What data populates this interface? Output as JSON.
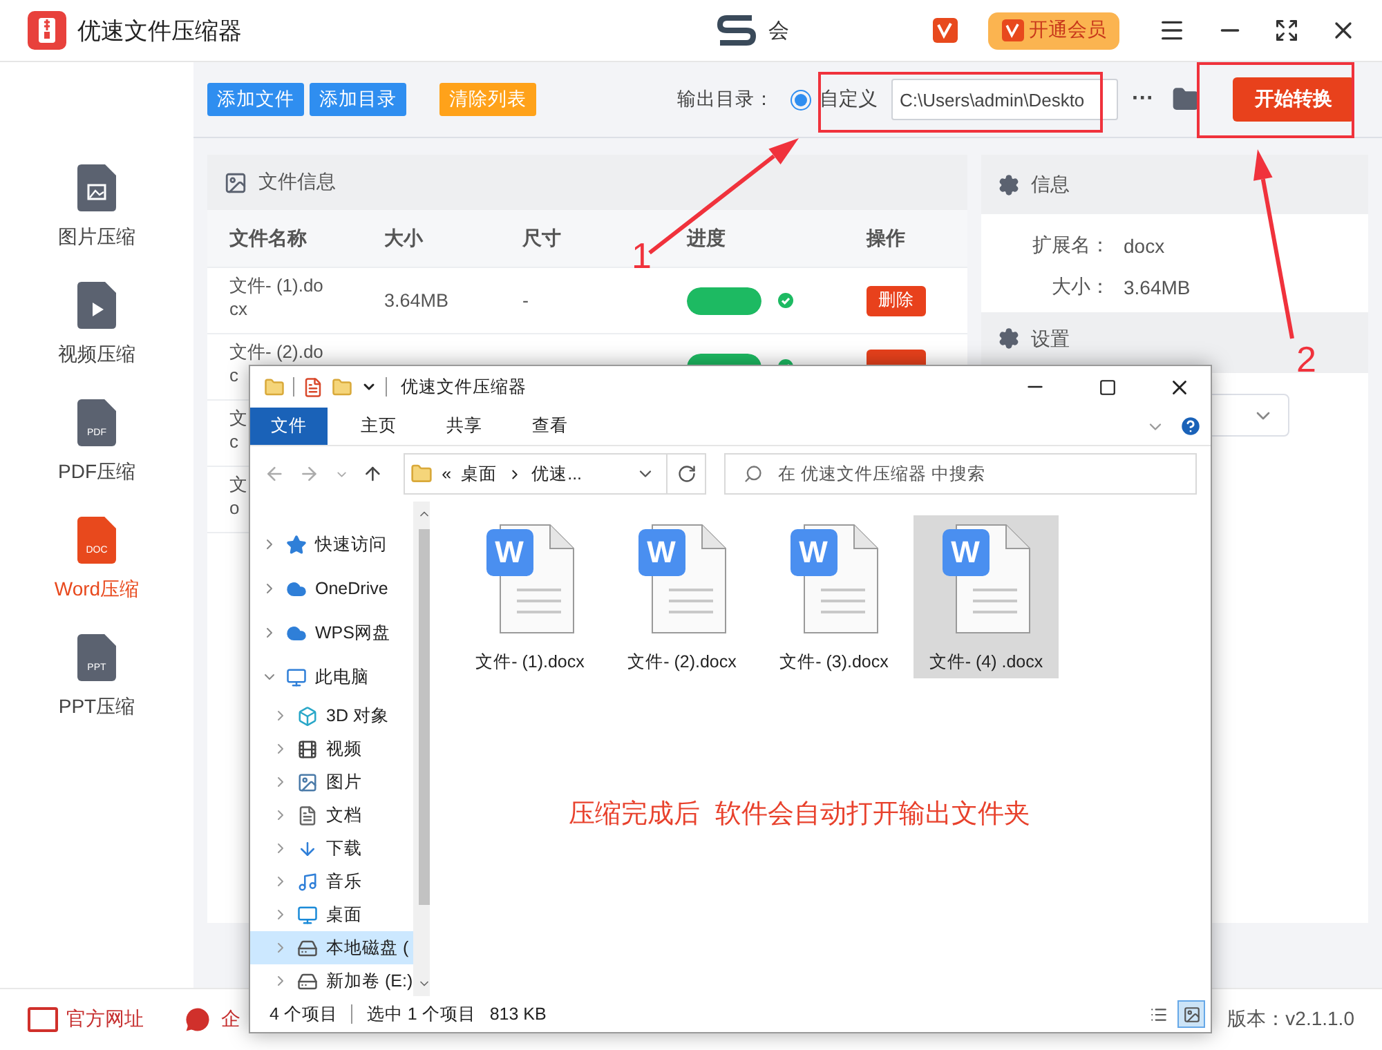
{
  "app": {
    "title": "优速文件压缩器",
    "user_name": "会",
    "vip_button": "开通会员"
  },
  "sidebar": {
    "items": [
      {
        "kind": "image",
        "label": "图片压缩",
        "selected": false
      },
      {
        "kind": "video",
        "label": "视频压缩",
        "selected": false
      },
      {
        "kind": "doc",
        "icon_label": "PDF",
        "label": "PDF压缩",
        "selected": false
      },
      {
        "kind": "doc",
        "icon_label": "DOC",
        "label": "Word压缩",
        "selected": true
      },
      {
        "kind": "doc",
        "icon_label": "PPT",
        "label": "PPT压缩",
        "selected": false
      }
    ]
  },
  "toolbar": {
    "buttons": [
      {
        "kind": "primary",
        "label": "添加文件"
      },
      {
        "kind": "primary",
        "label": "添加目录"
      },
      {
        "kind": "warning",
        "label": "清除列表"
      }
    ],
    "output": {
      "label": "输出目录：",
      "option": "自定义",
      "selected": true,
      "path": "C:\\Users\\admin\\Deskto",
      "more": "···"
    },
    "start_button": "开始转换"
  },
  "file_panel": {
    "title": "文件信息",
    "columns": [
      "文件名称",
      "大小",
      "尺寸",
      "进度",
      "操作"
    ],
    "rows": [
      {
        "name": "文件- (1).do\ncx",
        "size": "3.64MB",
        "dims": "-",
        "level": 1,
        "done": true,
        "action": "删除"
      },
      {
        "name": "文件- (2).do\nc",
        "level": 1,
        "done": true
      },
      {
        "name": "文\nc"
      },
      {
        "name": "文\no"
      }
    ]
  },
  "info_panel": {
    "title": "信息",
    "fields": [
      {
        "label": "扩展名：",
        "value": "docx"
      },
      {
        "label": "大小：",
        "value": "3.64MB"
      }
    ],
    "settings_title": "设置"
  },
  "annotations": {
    "labels": [
      "1",
      "2"
    ],
    "note": "压缩完成后  软件会自动打开输出文件夹"
  },
  "explorer": {
    "title": "优速文件压缩器",
    "tabs": [
      {
        "label": "文件",
        "selected": true
      },
      {
        "label": "主页",
        "selected": false
      },
      {
        "label": "共享",
        "selected": false
      },
      {
        "label": "查看",
        "selected": false
      }
    ],
    "address": {
      "overflow": "«",
      "crumbs": [
        "桌面",
        "优速..."
      ]
    },
    "search": {
      "placeholder": "在 优速文件压缩器 中搜索"
    },
    "tree": [
      {
        "kind": "star",
        "label": "快速访问",
        "expanded": false,
        "selected": false
      },
      {
        "kind": "cloud",
        "label": "OneDrive",
        "expanded": false,
        "selected": false
      },
      {
        "kind": "cloud",
        "label": "WPS网盘",
        "expanded": false,
        "selected": false
      },
      {
        "kind": "pc",
        "label": "此电脑",
        "expanded": true,
        "selected": false,
        "children": [
          {
            "kind": "cube",
            "label": "3D 对象",
            "selected": false
          },
          {
            "kind": "film",
            "label": "视频",
            "selected": false
          },
          {
            "kind": "picture",
            "label": "图片",
            "selected": false
          },
          {
            "kind": "document",
            "label": "文档",
            "selected": false
          },
          {
            "kind": "download",
            "label": "下载",
            "selected": false
          },
          {
            "kind": "music",
            "label": "音乐",
            "selected": false
          },
          {
            "kind": "desktop",
            "label": "桌面",
            "selected": false
          },
          {
            "kind": "drive",
            "label": "本地磁盘 (",
            "selected": true
          },
          {
            "kind": "drive",
            "label": "新加卷 (E:)",
            "selected": false
          }
        ]
      }
    ],
    "files": [
      {
        "name": "文件- (1).docx",
        "badge": "W",
        "selected": false
      },
      {
        "name": "文件- (2).docx",
        "badge": "W",
        "selected": false
      },
      {
        "name": "文件- (3).docx",
        "badge": "W",
        "selected": false
      },
      {
        "name": "文件- (4) .docx",
        "badge": "W",
        "selected": true
      }
    ],
    "status": {
      "count": "4 个项目",
      "selection": "选中 1 个项目",
      "size": "813 KB"
    },
    "views": [
      {
        "kind": "details",
        "selected": false
      },
      {
        "kind": "large",
        "selected": true
      }
    ]
  },
  "footer": {
    "links": [
      {
        "kind": "web",
        "label": "官方网址"
      },
      {
        "kind": "chat",
        "label": "企"
      }
    ],
    "version": "版本：v2.1.1.0"
  }
}
